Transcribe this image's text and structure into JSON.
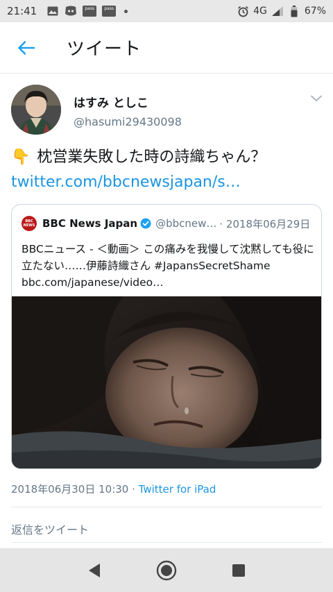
{
  "status_bar": {
    "time": "21:41",
    "network": "4G",
    "battery": "67%",
    "pass_label": "pass",
    "icons": [
      "image-icon",
      "discord-icon",
      "pass-icon",
      "pass-icon",
      "dot-icon",
      "alarm-icon",
      "signal-icon",
      "battery-icon"
    ]
  },
  "header": {
    "title": "ツイート",
    "back_icon": "back-arrow-icon"
  },
  "tweet": {
    "author_name": "はすみ としこ",
    "author_handle": "@hasumi29430098",
    "text": "枕営業失敗した時の詩織ちゃん？",
    "emoji": "👇",
    "link": "twitter.com/bbcnewsjapan/s…",
    "timestamp": "2018年06月30日 10:30",
    "separator": " · ",
    "source": "Twitter for iPad"
  },
  "quote": {
    "logo_text_1": "BBC",
    "logo_text_2": "NEWS",
    "name": "BBC News Japan",
    "handle": "@bbcnew…",
    "date": "· 2018年06月29日",
    "body": "BBCニュース - ＜動画＞ この痛みを我慢して沈黙しても役に立たない……伊藤詩織さん #JapansSecretShame bbc.com/japanese/video…",
    "accent": "#bb1919",
    "verified_color": "#1da1f2"
  },
  "actions": {
    "retweet_reply": "返信をツイート"
  },
  "colors": {
    "link": "#1b95e0",
    "secondary_text": "#657786",
    "border": "#ccd6dd"
  }
}
